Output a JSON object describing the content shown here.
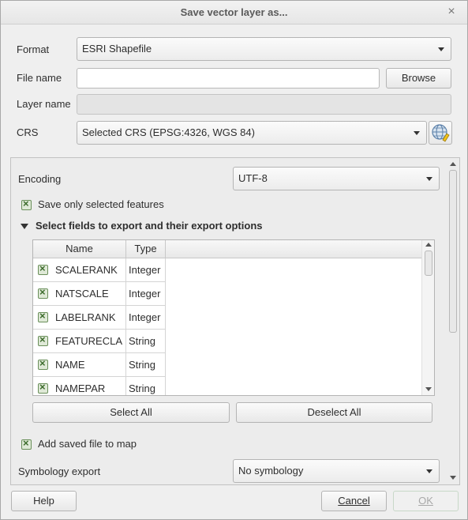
{
  "window": {
    "title": "Save vector layer as...",
    "close_glyph": "×"
  },
  "form": {
    "format_label": "Format",
    "format_value": "ESRI Shapefile",
    "filename_label": "File name",
    "filename_value": "",
    "browse_label": "Browse",
    "layername_label": "Layer name",
    "layername_value": "",
    "crs_label": "CRS",
    "crs_value": "Selected CRS (EPSG:4326, WGS 84)",
    "crs_icon": "globe-projection-icon"
  },
  "options": {
    "encoding_label": "Encoding",
    "encoding_value": "UTF-8",
    "save_selected_label": "Save only selected features",
    "save_selected_checked": true,
    "fields_section_title": "Select fields to export and their export options",
    "fields_columns": [
      "Name",
      "Type"
    ],
    "fields_rows": [
      {
        "name": "SCALERANK",
        "type": "Integer",
        "checked": true
      },
      {
        "name": "NATSCALE",
        "type": "Integer",
        "checked": true
      },
      {
        "name": "LABELRANK",
        "type": "Integer",
        "checked": true
      },
      {
        "name": "FEATURECLA",
        "type": "String",
        "checked": true
      },
      {
        "name": "NAME",
        "type": "String",
        "checked": true
      },
      {
        "name": "NAMEPAR",
        "type": "String",
        "checked": true
      }
    ],
    "select_all_label": "Select All",
    "deselect_all_label": "Deselect All",
    "add_to_map_label": "Add saved file to map",
    "add_to_map_checked": true,
    "symbology_label": "Symbology export",
    "symbology_value": "No symbology"
  },
  "buttons": {
    "help_label": "Help",
    "cancel_label": "Cancel",
    "ok_label": "OK"
  },
  "colors": {
    "checkbox_border": "#6a8f5a",
    "checkbox_fill": "#dfe9d7",
    "ok_border_disabled": "#c8d8c8"
  }
}
